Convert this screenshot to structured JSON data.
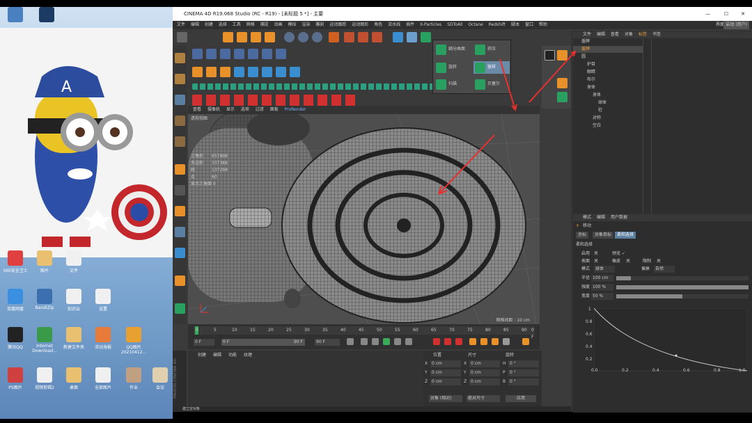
{
  "window": {
    "title": "CINEMA 4D R19.068 Studio (RC - R19) - [未标题 5 *] - 主要"
  },
  "menu": [
    "文件",
    "编辑",
    "创建",
    "选择",
    "工具",
    "网格",
    "捕捉",
    "动画",
    "模拟",
    "渲染",
    "雕刻",
    "运动跟踪",
    "运动图形",
    "角色",
    "流水线",
    "插件",
    "X-Particles",
    "SDToAll",
    "Octane",
    "Redshift",
    "脚本",
    "窗口",
    "帮助"
  ],
  "menu_right": [
    "界面",
    "启动 (用户)"
  ],
  "popup": {
    "items": [
      "细分曲面",
      "旋转",
      "扫描",
      "挤压",
      "放样",
      "贝塞尔"
    ]
  },
  "viewport": {
    "tabs": [
      "查看",
      "摄像机",
      "显示",
      "选项",
      "过滤",
      "面板",
      "ProRender"
    ],
    "title": "透视视图",
    "stats": [
      "三角形",
      "多边形",
      "线",
      "点",
      "显示三角面 0"
    ],
    "stat_values": [
      "657898",
      "337388",
      "137298",
      "60"
    ],
    "grid_label": "网格间距 : 10 cm"
  },
  "timeline": {
    "ticks": [
      "0",
      "5",
      "10",
      "15",
      "20",
      "25",
      "30",
      "35",
      "40",
      "45",
      "50",
      "55",
      "60",
      "65",
      "70",
      "75",
      "80",
      "85",
      "90"
    ],
    "start": "0 F",
    "current": "0 F",
    "end": "90 F",
    "max": "90 F",
    "end_frame": "0 F"
  },
  "bottom_panel": {
    "tabs": [
      "创建",
      "编辑",
      "功能",
      "纹理"
    ]
  },
  "coords": {
    "headers": [
      "位置",
      "尺寸",
      "旋转"
    ],
    "rows": [
      [
        "X",
        "0 cm",
        "X",
        "0 cm",
        "H",
        "0 °"
      ],
      [
        "Y",
        "0 cm",
        "Y",
        "0 cm",
        "P",
        "0 °"
      ],
      [
        "Z",
        "0 cm",
        "Z",
        "0 cm",
        "B",
        "0 °"
      ]
    ],
    "mode": "对象 (相对)",
    "size_mode": "绝对尺寸",
    "apply": "应用"
  },
  "objects": {
    "tabs": [
      "文件",
      "编辑",
      "查看",
      "对象",
      "标签",
      "书签"
    ],
    "items": [
      "盾牌",
      "盾牌",
      "圆",
      "护目",
      "眼睛",
      "布尔",
      "身体",
      "身体",
      "球体",
      "柱",
      "对称",
      "空白"
    ]
  },
  "attributes": {
    "tabs": [
      "模式",
      "编辑",
      "用户数据"
    ],
    "object": "移动",
    "subtabs": [
      "坐标",
      "对象目标",
      "柔和选择"
    ],
    "section": "柔和选择",
    "fields": [
      [
        "启用",
        "关",
        "预览 ✓"
      ],
      [
        "表面",
        "关",
        "橡皮",
        "关",
        "限制",
        "关"
      ],
      [
        "模式",
        "球体",
        "偏衰",
        "自然"
      ],
      [
        "半径",
        "100 cm"
      ],
      [
        "强度",
        "100 %"
      ],
      [
        "宽度",
        "50 %"
      ]
    ],
    "graph_y": [
      "1",
      "0.8",
      "0.6",
      "0.4",
      "0.2"
    ],
    "graph_x": [
      "0.0",
      "0.2",
      "0.4",
      "0.6",
      "0.8",
      "1.0"
    ]
  },
  "status": {
    "text": "建立空对象"
  },
  "desktop": {
    "icons": [
      "360安全卫士",
      "图片",
      "文件",
      "百度网盘",
      "BandiZip",
      "知识云",
      "设置",
      "腾讯QQ",
      "Internet Download...",
      "新建文件夹",
      "活动海报",
      "QQ图片20210412...",
      "PS图片",
      "视频剪辑2",
      "桌面",
      "全部图片",
      "作业",
      "会议"
    ]
  },
  "colors": {
    "accent": "#e83030",
    "selection": "#5a7fa0",
    "toolbar_orange": "#e8902a"
  }
}
